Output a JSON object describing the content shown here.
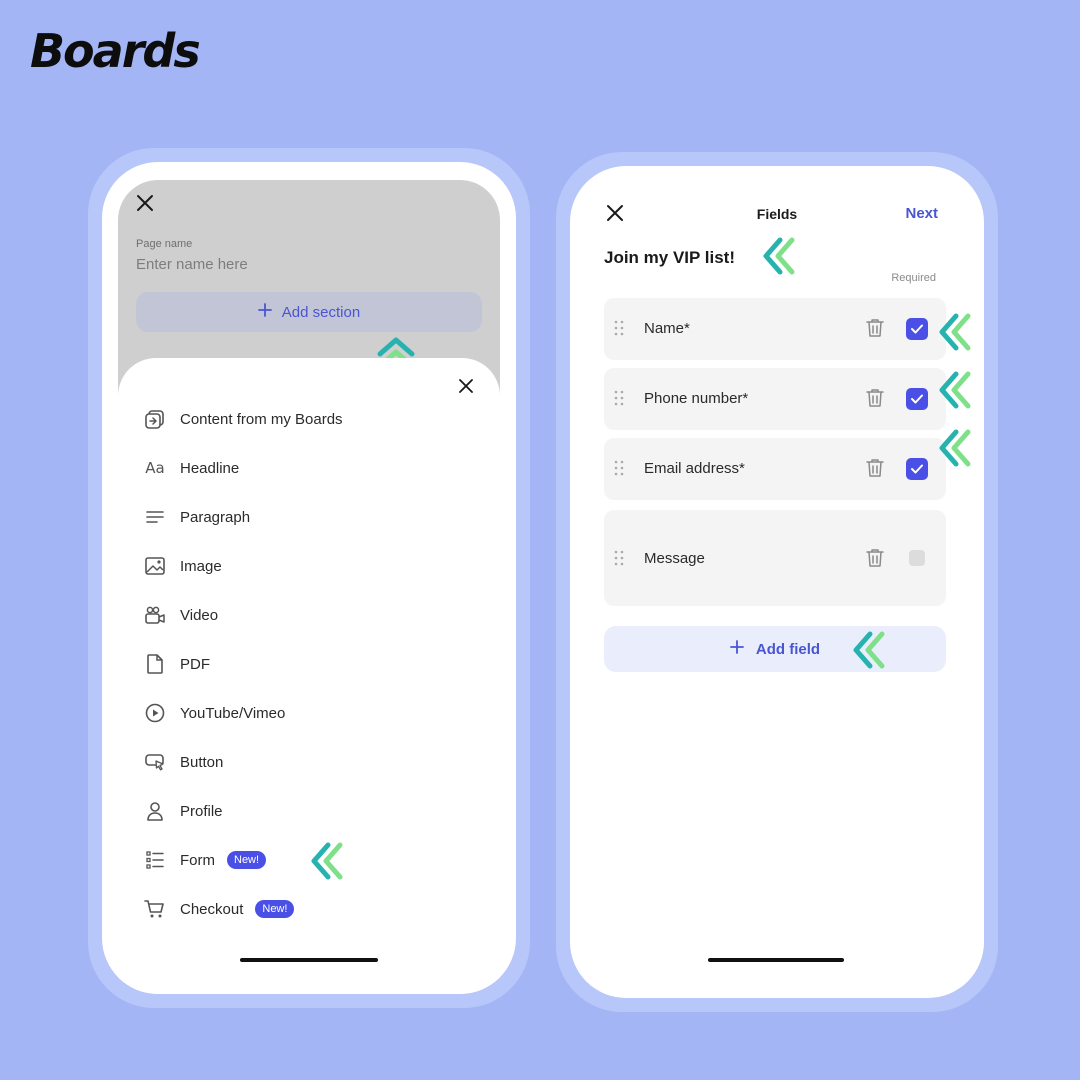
{
  "brand": {
    "logo": "Boards"
  },
  "colors": {
    "background": "#a3b5f5",
    "accent": "#4a50e6",
    "arrow_teal": "#26b3b0",
    "arrow_green": "#7fe08a"
  },
  "left_screen": {
    "page_name_label": "Page name",
    "page_name_placeholder": "Enter name here",
    "add_section_label": "Add section",
    "menu": [
      {
        "label": "Content from my Boards",
        "icon": "boards-content-icon"
      },
      {
        "label": "Headline",
        "icon": "text-icon"
      },
      {
        "label": "Paragraph",
        "icon": "paragraph-icon"
      },
      {
        "label": "Image",
        "icon": "image-icon"
      },
      {
        "label": "Video",
        "icon": "video-icon"
      },
      {
        "label": "PDF",
        "icon": "document-icon"
      },
      {
        "label": "YouTube/Vimeo",
        "icon": "play-icon"
      },
      {
        "label": "Button",
        "icon": "button-icon"
      },
      {
        "label": "Profile",
        "icon": "profile-icon"
      },
      {
        "label": "Form",
        "icon": "form-icon",
        "badge": "New!"
      },
      {
        "label": "Checkout",
        "icon": "cart-icon",
        "badge": "New!"
      }
    ]
  },
  "right_screen": {
    "title": "Fields",
    "next_label": "Next",
    "form_title": "Join my VIP list!",
    "required_label": "Required",
    "fields": [
      {
        "name": "Name*",
        "required": true
      },
      {
        "name": "Phone number*",
        "required": true
      },
      {
        "name": "Email address*",
        "required": true
      },
      {
        "name": "Message",
        "required": false
      }
    ],
    "add_field_label": "Add field"
  }
}
